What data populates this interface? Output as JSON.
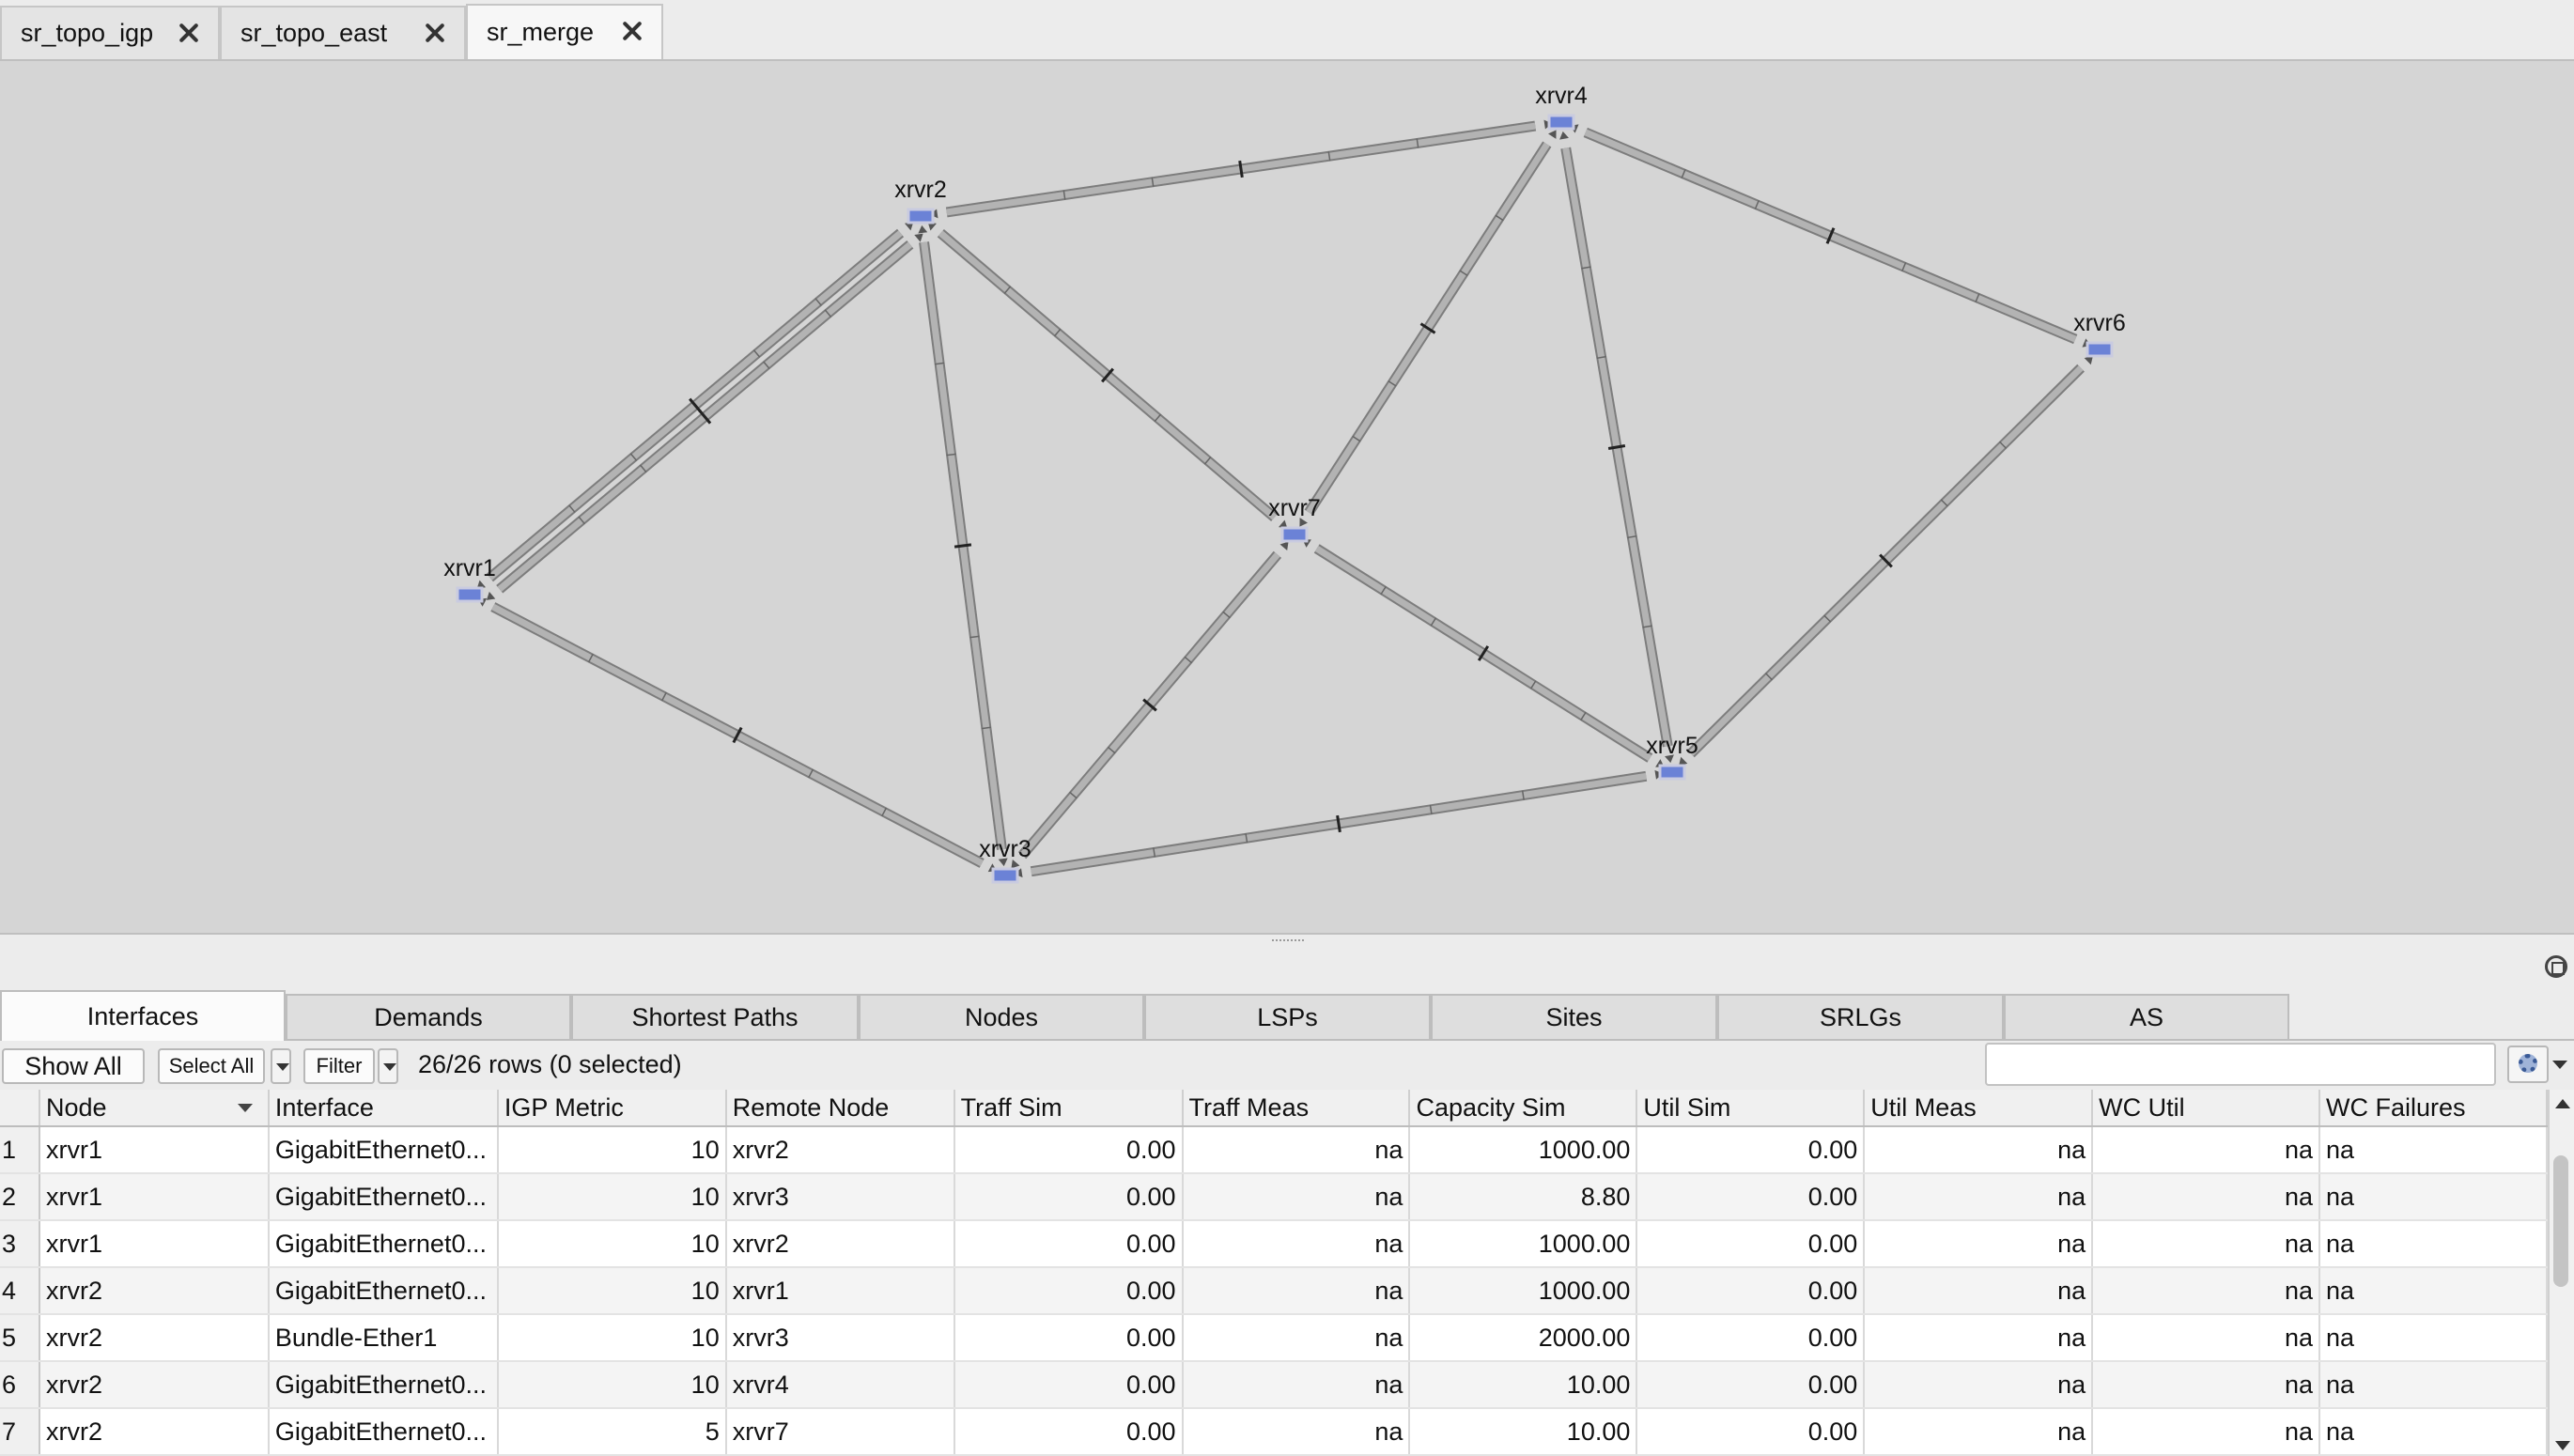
{
  "doc_tabs": [
    {
      "label": "sr_topo_igp",
      "active": false
    },
    {
      "label": "sr_topo_east",
      "active": false
    },
    {
      "label": "sr_merge",
      "active": true
    }
  ],
  "topology": {
    "nodes": [
      "xrvr1",
      "xrvr2",
      "xrvr3",
      "xrvr4",
      "xrvr5",
      "xrvr6",
      "xrvr7"
    ],
    "links": [
      [
        "xrvr1",
        "xrvr2"
      ],
      [
        "xrvr1",
        "xrvr2"
      ],
      [
        "xrvr1",
        "xrvr3"
      ],
      [
        "xrvr2",
        "xrvr3"
      ],
      [
        "xrvr2",
        "xrvr4"
      ],
      [
        "xrvr2",
        "xrvr7"
      ],
      [
        "xrvr3",
        "xrvr7"
      ],
      [
        "xrvr3",
        "xrvr5"
      ],
      [
        "xrvr4",
        "xrvr7"
      ],
      [
        "xrvr4",
        "xrvr5"
      ],
      [
        "xrvr4",
        "xrvr6"
      ],
      [
        "xrvr6",
        "xrvr5"
      ],
      [
        "xrvr7",
        "xrvr5"
      ]
    ],
    "node_color": "#6b82d6",
    "link_color": "#b3b3b3"
  },
  "view_tabs": [
    "Interfaces",
    "Demands",
    "Shortest Paths",
    "Nodes",
    "LSPs",
    "Sites",
    "SRLGs",
    "AS"
  ],
  "toolbar": {
    "show_all": "Show All",
    "select_all": "Select All",
    "filter": "Filter",
    "row_count": "26/26 rows (0 selected)",
    "search_value": ""
  },
  "table": {
    "columns": [
      "Node",
      "Interface",
      "IGP Metric",
      "Remote Node",
      "Traff Sim",
      "Traff Meas",
      "Capacity Sim",
      "Util Sim",
      "Util Meas",
      "WC Util",
      "WC Failures"
    ],
    "rows": [
      [
        "1",
        "xrvr1",
        "GigabitEthernet0...",
        "10",
        "xrvr2",
        "0.00",
        "na",
        "1000.00",
        "0.00",
        "na",
        "na",
        "na"
      ],
      [
        "2",
        "xrvr1",
        "GigabitEthernet0...",
        "10",
        "xrvr3",
        "0.00",
        "na",
        "8.80",
        "0.00",
        "na",
        "na",
        "na"
      ],
      [
        "3",
        "xrvr1",
        "GigabitEthernet0...",
        "10",
        "xrvr2",
        "0.00",
        "na",
        "1000.00",
        "0.00",
        "na",
        "na",
        "na"
      ],
      [
        "4",
        "xrvr2",
        "GigabitEthernet0...",
        "10",
        "xrvr1",
        "0.00",
        "na",
        "1000.00",
        "0.00",
        "na",
        "na",
        "na"
      ],
      [
        "5",
        "xrvr2",
        "Bundle-Ether1",
        "10",
        "xrvr3",
        "0.00",
        "na",
        "2000.00",
        "0.00",
        "na",
        "na",
        "na"
      ],
      [
        "6",
        "xrvr2",
        "GigabitEthernet0...",
        "10",
        "xrvr4",
        "0.00",
        "na",
        "10.00",
        "0.00",
        "na",
        "na",
        "na"
      ],
      [
        "7",
        "xrvr2",
        "GigabitEthernet0...",
        "5",
        "xrvr7",
        "0.00",
        "na",
        "10.00",
        "0.00",
        "na",
        "na",
        "na"
      ]
    ]
  }
}
